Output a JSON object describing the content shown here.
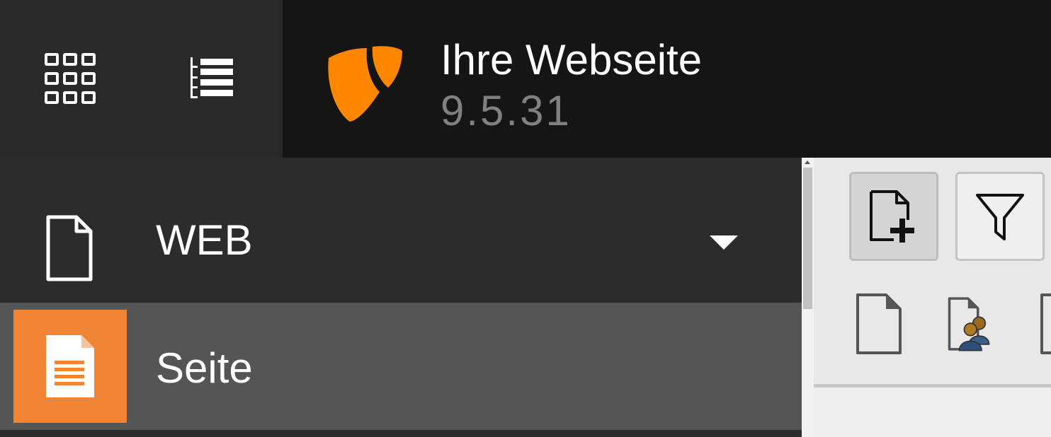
{
  "topbar": {
    "site_title": "Ihre Webseite",
    "site_version": "9.5.31",
    "logo_color": "#ff8700"
  },
  "module_menu": {
    "group": {
      "label": "WEB",
      "icon": "page-outline-icon"
    },
    "active_module": {
      "label": "Seite",
      "icon": "page-document-icon",
      "color": "#f08535"
    }
  },
  "doc_header": {
    "buttons": [
      {
        "icon": "new-page-icon"
      },
      {
        "icon": "filter-icon"
      }
    ],
    "page_types": [
      {
        "icon": "standard-page-icon"
      },
      {
        "icon": "backend-user-section-icon"
      },
      {
        "icon": "page-icon"
      }
    ]
  }
}
